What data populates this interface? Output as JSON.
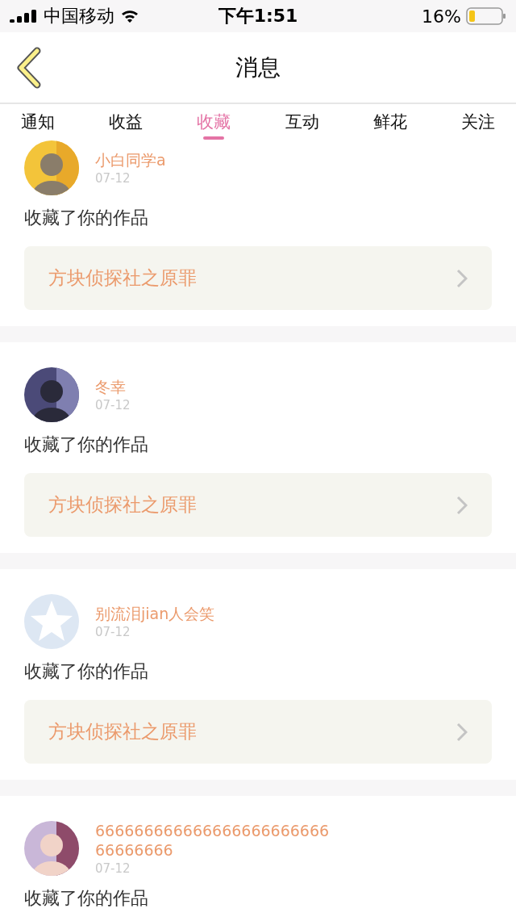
{
  "status_bar": {
    "carrier": "中国移动",
    "time": "下午1:51",
    "battery": "16%"
  },
  "nav": {
    "title": "消息"
  },
  "tabs": [
    {
      "label": "通知",
      "selected": false
    },
    {
      "label": "收益",
      "selected": false
    },
    {
      "label": "收藏",
      "selected": true
    },
    {
      "label": "互动",
      "selected": false
    },
    {
      "label": "鲜花",
      "selected": false
    },
    {
      "label": "关注",
      "selected": false
    }
  ],
  "messages": [
    {
      "name": "小白同学a",
      "date": "07-12",
      "action": "收藏了你的作品",
      "work": "方块侦探社之原罪"
    },
    {
      "name": "冬幸",
      "date": "07-12",
      "action": "收藏了你的作品",
      "work": "方块侦探社之原罪"
    },
    {
      "avatar": {
        "kind": "default"
      },
      "name": "别流泪jian人会笑",
      "date": "07-12",
      "action": "收藏了你的作品",
      "work": "方块侦探社之原罪"
    },
    {
      "name": "66666666666666666666666666666666",
      "date": "07-12",
      "action": "收藏了你的作品"
    }
  ]
}
